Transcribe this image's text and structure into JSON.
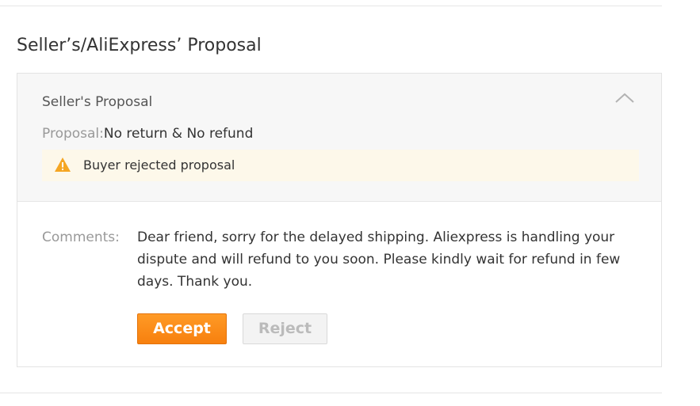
{
  "section": {
    "title": "Seller’s/AliExpress’ Proposal"
  },
  "proposal_card": {
    "subtitle": "Seller's Proposal",
    "collapse_icon": "chevron-up-icon",
    "proposal_label": "Proposal:",
    "proposal_value": "No return & No refund",
    "status": {
      "icon": "warning-icon",
      "text": "Buyer rejected proposal",
      "icon_color": "#f5a623",
      "background": "#fdf8ea"
    },
    "comments_label": "Comments:",
    "comments_text": "Dear friend, sorry for the delayed shipping. Aliexpress is handling your dispute and will refund to you soon. Please kindly wait for refund in few days. Thank you.",
    "accept_label": "Accept",
    "reject_label": "Reject"
  },
  "colors": {
    "accent": "#f7800e",
    "muted_text": "#999999",
    "disabled_text": "#bbbbbb"
  }
}
